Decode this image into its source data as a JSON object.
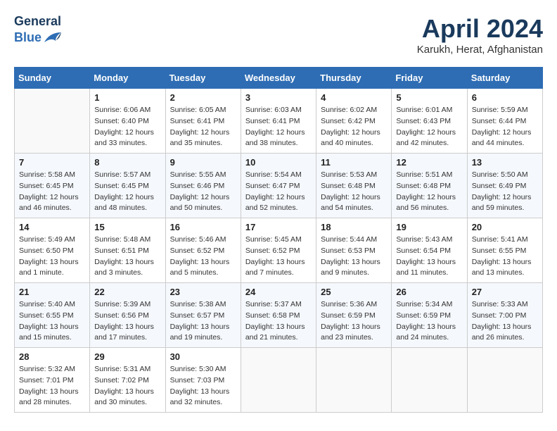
{
  "header": {
    "logo_line1": "General",
    "logo_line2": "Blue",
    "month_title": "April 2024",
    "location": "Karukh, Herat, Afghanistan"
  },
  "weekdays": [
    "Sunday",
    "Monday",
    "Tuesday",
    "Wednesday",
    "Thursday",
    "Friday",
    "Saturday"
  ],
  "weeks": [
    [
      {
        "day": "",
        "info": ""
      },
      {
        "day": "1",
        "info": "Sunrise: 6:06 AM\nSunset: 6:40 PM\nDaylight: 12 hours\nand 33 minutes."
      },
      {
        "day": "2",
        "info": "Sunrise: 6:05 AM\nSunset: 6:41 PM\nDaylight: 12 hours\nand 35 minutes."
      },
      {
        "day": "3",
        "info": "Sunrise: 6:03 AM\nSunset: 6:41 PM\nDaylight: 12 hours\nand 38 minutes."
      },
      {
        "day": "4",
        "info": "Sunrise: 6:02 AM\nSunset: 6:42 PM\nDaylight: 12 hours\nand 40 minutes."
      },
      {
        "day": "5",
        "info": "Sunrise: 6:01 AM\nSunset: 6:43 PM\nDaylight: 12 hours\nand 42 minutes."
      },
      {
        "day": "6",
        "info": "Sunrise: 5:59 AM\nSunset: 6:44 PM\nDaylight: 12 hours\nand 44 minutes."
      }
    ],
    [
      {
        "day": "7",
        "info": "Sunrise: 5:58 AM\nSunset: 6:45 PM\nDaylight: 12 hours\nand 46 minutes."
      },
      {
        "day": "8",
        "info": "Sunrise: 5:57 AM\nSunset: 6:45 PM\nDaylight: 12 hours\nand 48 minutes."
      },
      {
        "day": "9",
        "info": "Sunrise: 5:55 AM\nSunset: 6:46 PM\nDaylight: 12 hours\nand 50 minutes."
      },
      {
        "day": "10",
        "info": "Sunrise: 5:54 AM\nSunset: 6:47 PM\nDaylight: 12 hours\nand 52 minutes."
      },
      {
        "day": "11",
        "info": "Sunrise: 5:53 AM\nSunset: 6:48 PM\nDaylight: 12 hours\nand 54 minutes."
      },
      {
        "day": "12",
        "info": "Sunrise: 5:51 AM\nSunset: 6:48 PM\nDaylight: 12 hours\nand 56 minutes."
      },
      {
        "day": "13",
        "info": "Sunrise: 5:50 AM\nSunset: 6:49 PM\nDaylight: 12 hours\nand 59 minutes."
      }
    ],
    [
      {
        "day": "14",
        "info": "Sunrise: 5:49 AM\nSunset: 6:50 PM\nDaylight: 13 hours\nand 1 minute."
      },
      {
        "day": "15",
        "info": "Sunrise: 5:48 AM\nSunset: 6:51 PM\nDaylight: 13 hours\nand 3 minutes."
      },
      {
        "day": "16",
        "info": "Sunrise: 5:46 AM\nSunset: 6:52 PM\nDaylight: 13 hours\nand 5 minutes."
      },
      {
        "day": "17",
        "info": "Sunrise: 5:45 AM\nSunset: 6:52 PM\nDaylight: 13 hours\nand 7 minutes."
      },
      {
        "day": "18",
        "info": "Sunrise: 5:44 AM\nSunset: 6:53 PM\nDaylight: 13 hours\nand 9 minutes."
      },
      {
        "day": "19",
        "info": "Sunrise: 5:43 AM\nSunset: 6:54 PM\nDaylight: 13 hours\nand 11 minutes."
      },
      {
        "day": "20",
        "info": "Sunrise: 5:41 AM\nSunset: 6:55 PM\nDaylight: 13 hours\nand 13 minutes."
      }
    ],
    [
      {
        "day": "21",
        "info": "Sunrise: 5:40 AM\nSunset: 6:55 PM\nDaylight: 13 hours\nand 15 minutes."
      },
      {
        "day": "22",
        "info": "Sunrise: 5:39 AM\nSunset: 6:56 PM\nDaylight: 13 hours\nand 17 minutes."
      },
      {
        "day": "23",
        "info": "Sunrise: 5:38 AM\nSunset: 6:57 PM\nDaylight: 13 hours\nand 19 minutes."
      },
      {
        "day": "24",
        "info": "Sunrise: 5:37 AM\nSunset: 6:58 PM\nDaylight: 13 hours\nand 21 minutes."
      },
      {
        "day": "25",
        "info": "Sunrise: 5:36 AM\nSunset: 6:59 PM\nDaylight: 13 hours\nand 23 minutes."
      },
      {
        "day": "26",
        "info": "Sunrise: 5:34 AM\nSunset: 6:59 PM\nDaylight: 13 hours\nand 24 minutes."
      },
      {
        "day": "27",
        "info": "Sunrise: 5:33 AM\nSunset: 7:00 PM\nDaylight: 13 hours\nand 26 minutes."
      }
    ],
    [
      {
        "day": "28",
        "info": "Sunrise: 5:32 AM\nSunset: 7:01 PM\nDaylight: 13 hours\nand 28 minutes."
      },
      {
        "day": "29",
        "info": "Sunrise: 5:31 AM\nSunset: 7:02 PM\nDaylight: 13 hours\nand 30 minutes."
      },
      {
        "day": "30",
        "info": "Sunrise: 5:30 AM\nSunset: 7:03 PM\nDaylight: 13 hours\nand 32 minutes."
      },
      {
        "day": "",
        "info": ""
      },
      {
        "day": "",
        "info": ""
      },
      {
        "day": "",
        "info": ""
      },
      {
        "day": "",
        "info": ""
      }
    ]
  ]
}
